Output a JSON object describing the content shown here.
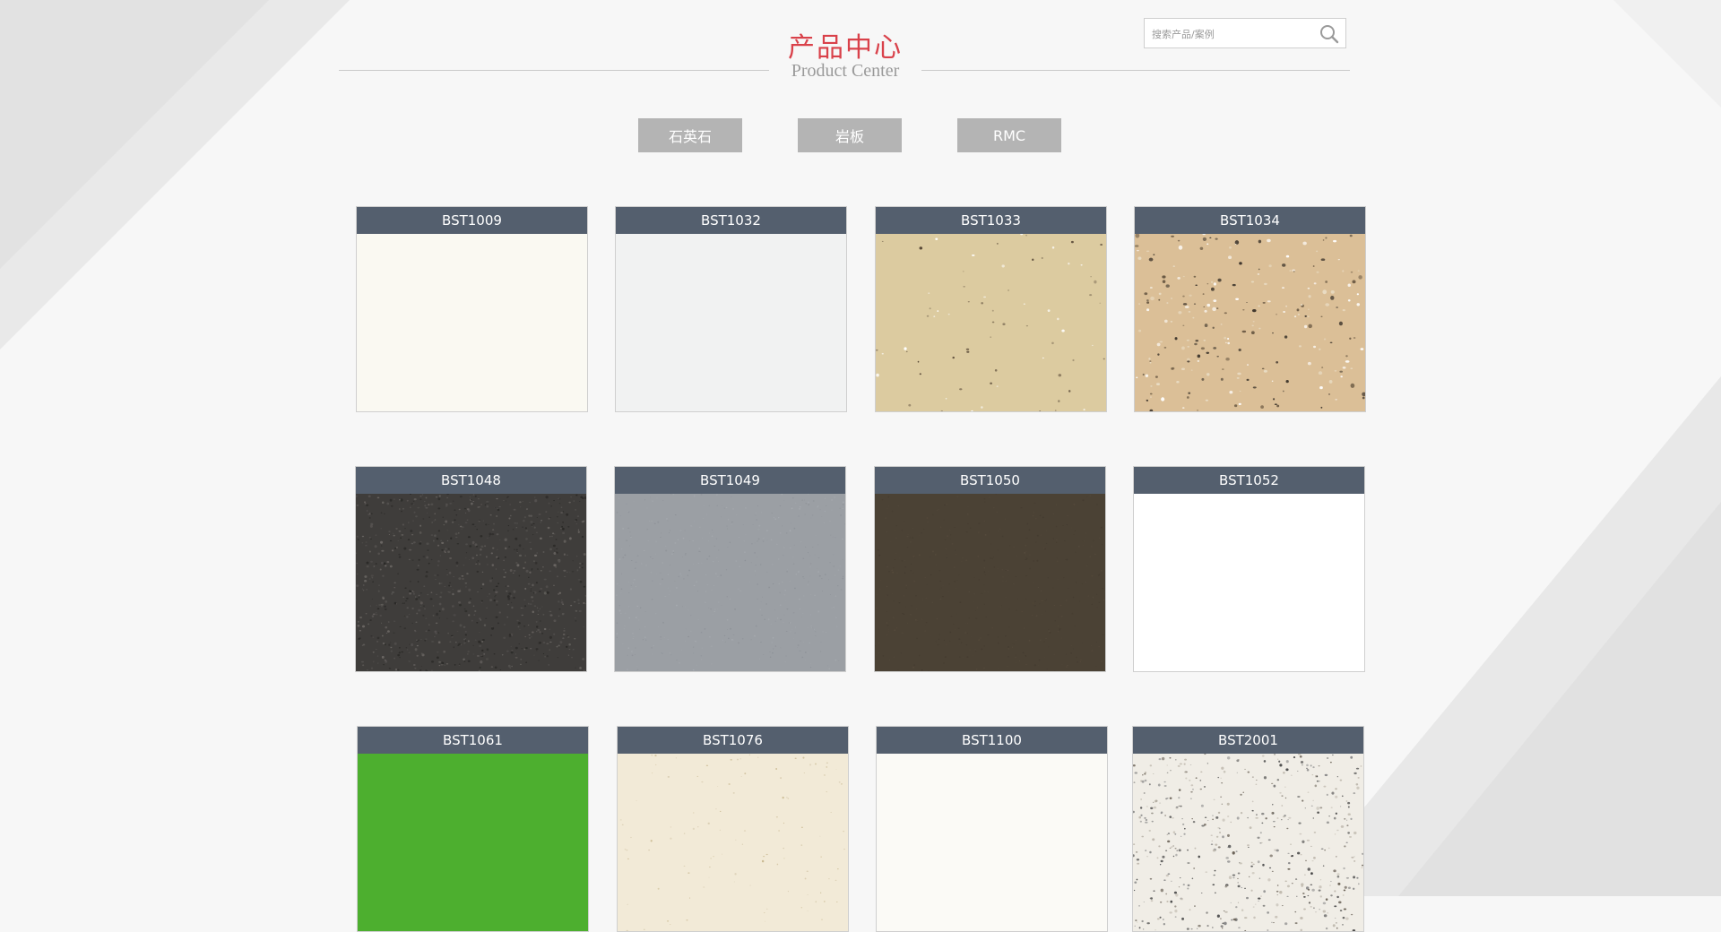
{
  "header": {
    "title_cn": "产品中心",
    "title_en": "Product Center"
  },
  "search": {
    "placeholder": "搜索产品/案例"
  },
  "tabs": [
    {
      "label": "石英石"
    },
    {
      "label": "岩板"
    },
    {
      "label": "RMC"
    }
  ],
  "products": [
    {
      "code": "BST1009",
      "color": "#faf9f2",
      "speckle": "none"
    },
    {
      "code": "BST1032",
      "color": "#f1f2f2",
      "speckle": "none"
    },
    {
      "code": "BST1033",
      "color": "#dccba0",
      "speckle": "sparse-dark"
    },
    {
      "code": "BST1034",
      "color": "#dbbf97",
      "speckle": "dense-mixed"
    },
    {
      "code": "BST1048",
      "color": "#3f3d3b",
      "speckle": "fine-dark"
    },
    {
      "code": "BST1049",
      "color": "#9b9fa4",
      "speckle": "fine-grey"
    },
    {
      "code": "BST1050",
      "color": "#4b4235",
      "speckle": "fine-brown"
    },
    {
      "code": "BST1052",
      "color": "#ffffff",
      "speckle": "none"
    },
    {
      "code": "BST1061",
      "color": "#4daf2f",
      "speckle": "none"
    },
    {
      "code": "BST1076",
      "color": "#f2ead7",
      "speckle": "sparse-light"
    },
    {
      "code": "BST1100",
      "color": "#fbfaf6",
      "speckle": "none"
    },
    {
      "code": "BST2001",
      "color": "#f0ede6",
      "speckle": "dense-dark"
    }
  ]
}
